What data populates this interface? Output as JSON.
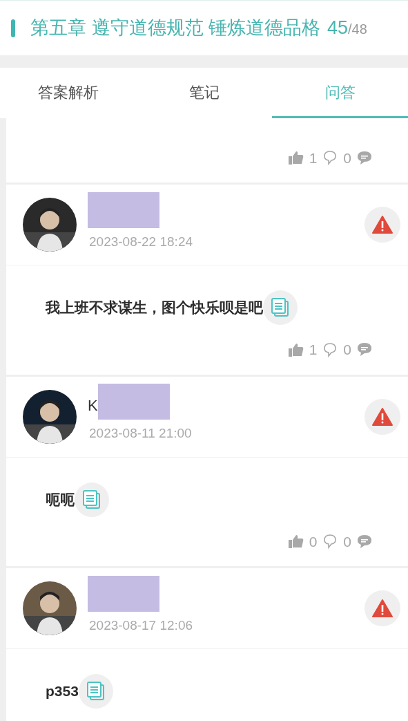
{
  "header": {
    "title": "第五章 遵守道德规范 锤炼道德品格",
    "current": "45",
    "total": "/48"
  },
  "tabs": [
    {
      "label": "答案解析",
      "selected": false
    },
    {
      "label": "笔记",
      "selected": false
    },
    {
      "label": "问答",
      "selected": true
    }
  ],
  "partial_post": {
    "likes": "1",
    "second_count": "0"
  },
  "posts": [
    {
      "time": "2023-08-22 18:24",
      "text": "我上班不求谋生，图个快乐呗是吧",
      "likes": "1",
      "second_count": "0"
    },
    {
      "name_visible": "K",
      "time": "2023-08-11 21:00",
      "text": "呃呃",
      "likes": "0",
      "second_count": "0"
    },
    {
      "time": "2023-08-17 12:06",
      "text": "p353"
    }
  ]
}
